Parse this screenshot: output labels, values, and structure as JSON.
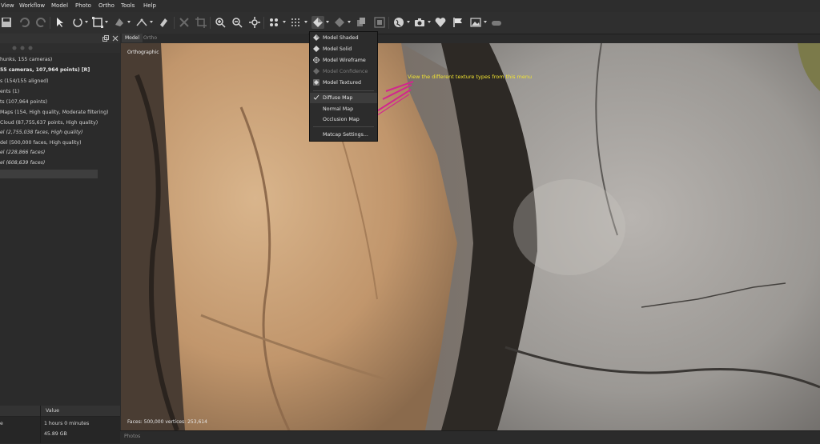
{
  "menubar": {
    "items": [
      "View",
      "Workflow",
      "Model",
      "Photo",
      "Ortho",
      "Tools",
      "Help"
    ]
  },
  "toolbar": {
    "icons": [
      "save-icon",
      "undo-icon",
      "redo-icon",
      "pointer-icon",
      "rotate-icon",
      "region-icon",
      "polygon-icon",
      "ruler-icon",
      "eraser-icon",
      "delete-icon",
      "crop-icon",
      "zoom-in-icon",
      "zoom-out-icon",
      "navigate-icon",
      "points-icon",
      "grid-points-icon",
      "model-shaded-icon",
      "texture-icon",
      "layers-icon",
      "camera-grid-icon",
      "globe-icon",
      "camera-icon",
      "heart-icon",
      "flag-icon",
      "image-icon",
      "marker-icon"
    ]
  },
  "workspace": {
    "items": [
      {
        "text": "hunks, 155 cameras)",
        "style": "normal"
      },
      {
        "text": "55 cameras, 107,964 points) [R]",
        "style": "bold"
      },
      {
        "text": "s (154/155 aligned)",
        "style": "normal"
      },
      {
        "text": "ents (1)",
        "style": "normal"
      },
      {
        "text": "ts (107,964 points)",
        "style": "normal"
      },
      {
        "text": "Maps (154, High quality, Moderate filtering)",
        "style": "normal"
      },
      {
        "text": "Cloud (87,755,637 points, High quality)",
        "style": "normal"
      },
      {
        "text": "el (2,755,038 faces, High quality)",
        "style": "italic"
      },
      {
        "text": "del (500,000 faces, High quality)",
        "style": "normal"
      },
      {
        "text": "el (228,866 faces)",
        "style": "italic"
      },
      {
        "text": "el (608,639 faces)",
        "style": "italic"
      }
    ]
  },
  "properties": {
    "header_value": "Value",
    "rows": [
      {
        "prop": "e",
        "value": "1 hours 0 minutes"
      },
      {
        "prop": "",
        "value": "45.89 GB"
      }
    ]
  },
  "tabs": {
    "model": "Model",
    "ortho": "Ortho"
  },
  "viewport": {
    "projection": "Orthographic",
    "status": "Faces: 500,000 vertices: 253,614",
    "annotation": "View the different texture types from this menu"
  },
  "texture_menu": {
    "modes": [
      {
        "label": "Model Shaded",
        "icon": "model-shaded-icon",
        "enabled": true
      },
      {
        "label": "Model Solid",
        "icon": "model-solid-icon",
        "enabled": true
      },
      {
        "label": "Model Wireframe",
        "icon": "model-wireframe-icon",
        "enabled": true
      },
      {
        "label": "Model Confidence",
        "icon": "model-confidence-icon",
        "enabled": false
      },
      {
        "label": "Model Textured",
        "icon": "model-textured-icon",
        "enabled": true
      }
    ],
    "textures": [
      {
        "label": "Diffuse Map",
        "checked": true
      },
      {
        "label": "Normal Map",
        "checked": false
      },
      {
        "label": "Occlusion Map",
        "checked": false
      }
    ],
    "settings": "Matcap Settings..."
  },
  "bottom_strip": {
    "label": "Photos"
  },
  "colors": {
    "annotation": "#f2e431",
    "pen_marks": "#d2268e",
    "background": "#2b2b2b"
  }
}
